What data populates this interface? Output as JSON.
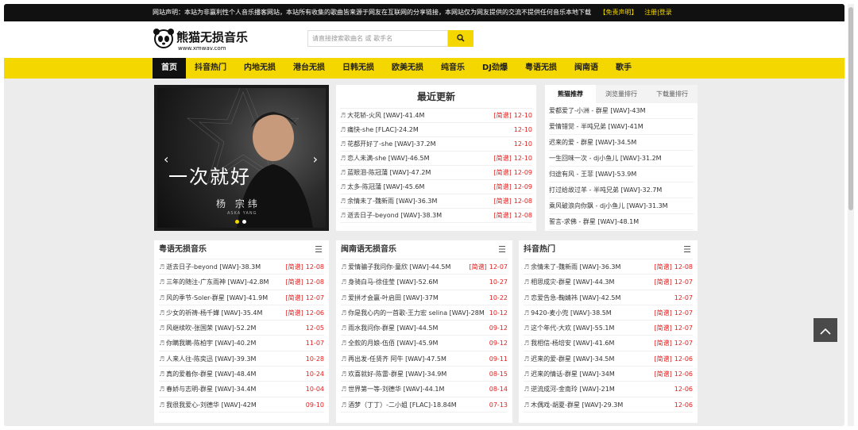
{
  "notice": {
    "text": "网站声明：本站为非赢利性个人音乐播客网站，本站所有收集的歌曲皆来源于网友在互联网的分享链接，本网站仅为网友提供的交流不提供任何音乐本地下载",
    "disclaimer": "【免责声明】",
    "auth": "注册|登录"
  },
  "header": {
    "logo_text": "熊猫无损音乐",
    "logo_url": "www.xmwav.com",
    "search_placeholder": "请直接搜索歌曲名 或 歌手名",
    "search_icon": "search-icon"
  },
  "nav": [
    "首页",
    "抖音热门",
    "内地无损",
    "港台无损",
    "日韩无损",
    "欧美无损",
    "纯音乐",
    "DJ劲爆",
    "粤语无损",
    "闽南语",
    "歌手"
  ],
  "banner": {
    "title": "一次就好",
    "singer": "杨 宗纬",
    "singer_en": "ASKA YANG"
  },
  "latest": {
    "title": "最近更新",
    "items": [
      {
        "song": "大花轿-火风  [WAV]-41.4M",
        "tag": "[简谱]",
        "date": "12-10"
      },
      {
        "song": "痛快-she  [FLAC]-24.2M",
        "tag": "",
        "date": "12-10"
      },
      {
        "song": "花都开好了-she  [WAV]-37.2M",
        "tag": "",
        "date": "12-10"
      },
      {
        "song": "恋人未满-she  [WAV]-46.5M",
        "tag": "[简谱]",
        "date": "12-10"
      },
      {
        "song": "蓝眼泪-陈冠蒲  [WAV]-47.2M",
        "tag": "[简谱]",
        "date": "12-09"
      },
      {
        "song": "太多-陈冠蒲  [WAV]-45.6M",
        "tag": "[简谱]",
        "date": "12-09"
      },
      {
        "song": "余情未了-魏新雨  [WAV]-36.3M",
        "tag": "[简谱]",
        "date": "12-08"
      },
      {
        "song": "逝去日子-beyond  [WAV]-38.3M",
        "tag": "[简谱]",
        "date": "12-08"
      }
    ]
  },
  "rank": {
    "tabs": [
      "熊猫推荐",
      "浏览量排行",
      "下载量排行"
    ],
    "items": [
      "爱都爱了-小洲 - 群星  [WAV]-43M",
      "爱情错觉 - 半吨兄弟  [WAV]-41M",
      "迟来的爱 - 群星  [WAV]-34.5M",
      "一生回味一次 - dj小鱼儿  [WAV]-31.2M",
      "归途有风 - 王菲  [WAV]-53.9M",
      "打过给故过羊 - 半吨兄弟  [WAV]-32.7M",
      "乘风破浪向你飘 - dj小鱼儿  [WAV]-31.3M",
      "誓言-求佛 - 群星  [WAV]-48.1M"
    ]
  },
  "sections": [
    {
      "title": "粤语无损音乐",
      "items": [
        {
          "song": "逝去日子-beyond  [WAV]-38.3M",
          "tag": "[简谱]",
          "date": "12-08"
        },
        {
          "song": "三年的随注-广东雨神  [WAV]-42.8M",
          "tag": "[简谱]",
          "date": "12-08"
        },
        {
          "song": "风的季节-Soler-群星  [WAV]-41.9M",
          "tag": "[简谱]",
          "date": "12-07"
        },
        {
          "song": "少女的祈祷-杨千嬅  [WAV]-35.4M",
          "tag": "[简谱]",
          "date": "12-06"
        },
        {
          "song": "风继续吹-张国荣  [WAV]-52.2M",
          "tag": "",
          "date": "12-05"
        },
        {
          "song": "你瞒我瞒-陈柏宇  [WAV]-40.2M",
          "tag": "",
          "date": "11-07"
        },
        {
          "song": "人来人往-陈奕迅  [WAV]-39.3M",
          "tag": "",
          "date": "10-28"
        },
        {
          "song": "真的爱着你-群星  [WAV]-48.4M",
          "tag": "",
          "date": "10-24"
        },
        {
          "song": "春娇与志明-群星  [WAV]-34.4M",
          "tag": "",
          "date": "10-04"
        },
        {
          "song": "我很我爱心-刘德华  [WAV]-42M",
          "tag": "",
          "date": "09-10"
        }
      ]
    },
    {
      "title": "闽南语无损音乐",
      "items": [
        {
          "song": "爱情骗子我问你-童欣  [WAV]-44.5M",
          "tag": "[简谱]",
          "date": "12-07"
        },
        {
          "song": "身骑白马-徐佳莹  [WAV]-52.6M",
          "tag": "",
          "date": "10-27"
        },
        {
          "song": "爱拼才会赢-叶启田  [WAV]-37M",
          "tag": "",
          "date": "10-22"
        },
        {
          "song": "你是我心内的一首歌-王力宏 selina  [WAV]-28M",
          "tag": "",
          "date": "10-12"
        },
        {
          "song": "雨水我问你-群星  [WAV]-44.5M",
          "tag": "",
          "date": "09-12"
        },
        {
          "song": "全款的月娘-伍佰  [WAV]-45.9M",
          "tag": "",
          "date": "09-12"
        },
        {
          "song": "再出发-任贤齐 阿牛  [WAV]-47.5M",
          "tag": "",
          "date": "09-11"
        },
        {
          "song": "欢喜就好-陈雷-群星  [WAV]-34.9M",
          "tag": "",
          "date": "08-15"
        },
        {
          "song": "世界第一等-刘德华  [WAV]-44.1M",
          "tag": "",
          "date": "08-14"
        },
        {
          "song": "酒梦（丁丁）-二小姐  [FLAC]-18.84M",
          "tag": "",
          "date": "07-13"
        }
      ]
    },
    {
      "title": "抖音热门",
      "items": [
        {
          "song": "余情未了-魏新雨  [WAV]-36.3M",
          "tag": "[简谱]",
          "date": "12-08"
        },
        {
          "song": "相思成灾-群星  [WAV]-44.3M",
          "tag": "[简谱]",
          "date": "12-07"
        },
        {
          "song": "恋爱告急-鞠婧祎  [WAV]-42.5M",
          "tag": "",
          "date": "12-07"
        },
        {
          "song": "9420-麦小兜  [WAV]-38.5M",
          "tag": "[简谱]",
          "date": "12-07"
        },
        {
          "song": "这个年代-大欢  [WAV]-55.1M",
          "tag": "[简谱]",
          "date": "12-07"
        },
        {
          "song": "我相信-杨培安  [WAV]-41.6M",
          "tag": "[简谱]",
          "date": "12-07"
        },
        {
          "song": "迟来的爱-群星  [WAV]-34.5M",
          "tag": "[简谱]",
          "date": "12-06"
        },
        {
          "song": "迟来的情话-群星  [WAV]-34M",
          "tag": "[简谱]",
          "date": "12-06"
        },
        {
          "song": "逆流成河-金南玲  [WAV]-21M",
          "tag": "",
          "date": "12-06"
        },
        {
          "song": "木偶戏-胡夏-群星  [WAV]-29.3M",
          "tag": "",
          "date": "12-06"
        }
      ]
    }
  ]
}
